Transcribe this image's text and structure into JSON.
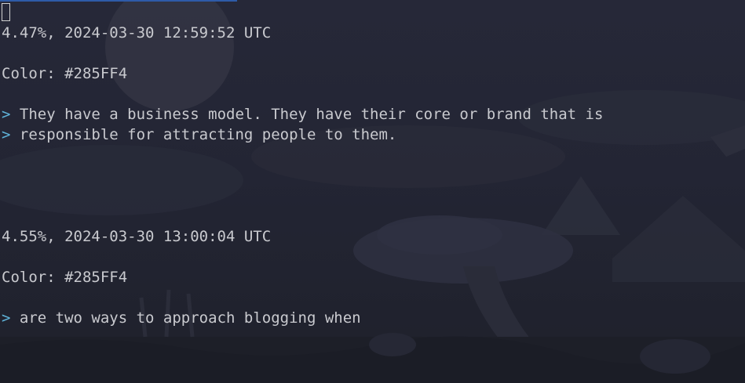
{
  "progress": 0.318,
  "colors": {
    "quote_marker": "#5fb3d9",
    "text": "#c9cacf",
    "progress_bar": "#2e5ba8"
  },
  "entries": [
    {
      "header": "4.47%, 2024-03-30 12:59:52 UTC",
      "color_line": "Color: #285FF4",
      "quote_lines": [
        "They have a business model. They have their core or brand that is",
        "responsible for attracting people to them."
      ]
    },
    {
      "header": "4.55%, 2024-03-30 13:00:04 UTC",
      "color_line": "Color: #285FF4",
      "quote_lines": [
        "are two ways to approach blogging when"
      ]
    }
  ],
  "quote_marker": ">"
}
